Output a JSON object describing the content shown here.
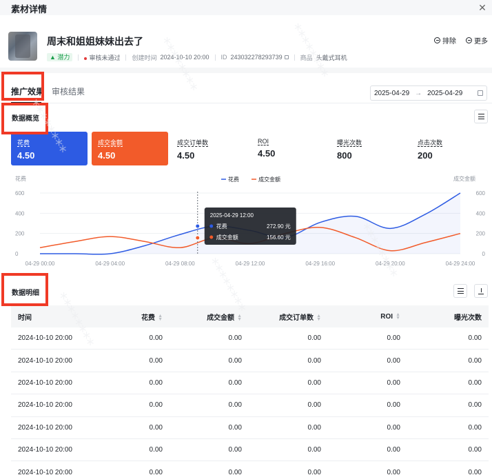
{
  "dialog": {
    "title": "素材详情",
    "close_icon": "close-icon"
  },
  "material": {
    "title": "周末和姐姐妹妹出去了",
    "badge": "潜力",
    "review_status": "审核未通过",
    "created_label": "创建时间",
    "created_time": "2024-10-10 20:00",
    "id_label": "ID",
    "id_value": "243032278293739",
    "product_label": "商品",
    "product_value": "头戴式耳机",
    "actions": {
      "exclude": "排除",
      "more": "更多"
    }
  },
  "tabs": [
    {
      "label": "推广效果",
      "active": true
    },
    {
      "label": "审核结果",
      "active": false
    }
  ],
  "date_range": {
    "start": "2025-04-29",
    "end": "2025-04-29"
  },
  "overview": {
    "title": "数据概览",
    "metrics": [
      {
        "label": "花费",
        "value": "4.50",
        "style": "blue"
      },
      {
        "label": "成交金额",
        "value": "4.50",
        "style": "orange"
      },
      {
        "label": "成交订单数",
        "value": "4.50",
        "style": "plain"
      },
      {
        "label": "ROI",
        "value": "4.50",
        "style": "plain"
      },
      {
        "label": "曝光次数",
        "value": "800",
        "style": "plain"
      },
      {
        "label": "点击次数",
        "value": "200",
        "style": "plain"
      }
    ]
  },
  "chart_data": {
    "type": "line",
    "left_axis_label": "花费",
    "right_axis_label": "成交金额",
    "y_ticks": [
      0,
      200,
      400,
      600
    ],
    "ylim": [
      0,
      600
    ],
    "x_tick_labels": [
      "04-29 00:00",
      "04-29 04:00",
      "04-29 08:00",
      "04-29 12:00",
      "04-29 16:00",
      "04-29 20:00",
      "04-29 24:00"
    ],
    "x": [
      0,
      2,
      4,
      6,
      8,
      10,
      12,
      14,
      16,
      18,
      20,
      22,
      24
    ],
    "series": [
      {
        "name": "花费",
        "color": "#2d5be3",
        "values": [
          0,
          0,
          0,
          80,
          190,
          272.9,
          230,
          160,
          310,
          370,
          250,
          390,
          600
        ]
      },
      {
        "name": "成交金额",
        "color": "#f25b2a",
        "values": [
          60,
          120,
          170,
          120,
          60,
          156.6,
          100,
          200,
          260,
          160,
          30,
          110,
          200
        ]
      }
    ],
    "tooltip": {
      "title": "2025-04-29 12:00",
      "rows": [
        {
          "name": "花费",
          "value": "272.90 元",
          "color": "#2d5be3"
        },
        {
          "name": "成交金额",
          "value": "156.60 元",
          "color": "#f25b2a"
        }
      ],
      "x": 9
    }
  },
  "detail": {
    "title": "数据明细",
    "columns": [
      "时间",
      "花费",
      "成交金额",
      "成交订单数",
      "ROI",
      "曝光次数"
    ],
    "rows": [
      [
        "2024-10-10 20:00",
        "0.00",
        "0.00",
        "0.00",
        "0.00",
        "0.00"
      ],
      [
        "2024-10-10 20:00",
        "0.00",
        "0.00",
        "0.00",
        "0.00",
        "0.00"
      ],
      [
        "2024-10-10 20:00",
        "0.00",
        "0.00",
        "0.00",
        "0.00",
        "0.00"
      ],
      [
        "2024-10-10 20:00",
        "0.00",
        "0.00",
        "0.00",
        "0.00",
        "0.00"
      ],
      [
        "2024-10-10 20:00",
        "0.00",
        "0.00",
        "0.00",
        "0.00",
        "0.00"
      ],
      [
        "2024-10-10 20:00",
        "0.00",
        "0.00",
        "0.00",
        "0.00",
        "0.00"
      ],
      [
        "2024-10-10 20:00",
        "0.00",
        "0.00",
        "0.00",
        "0.00",
        "0.00"
      ]
    ]
  },
  "colors": {
    "highlight_box": "#f03a26",
    "spend": "#2d5be3",
    "gmv": "#f25b2a"
  }
}
